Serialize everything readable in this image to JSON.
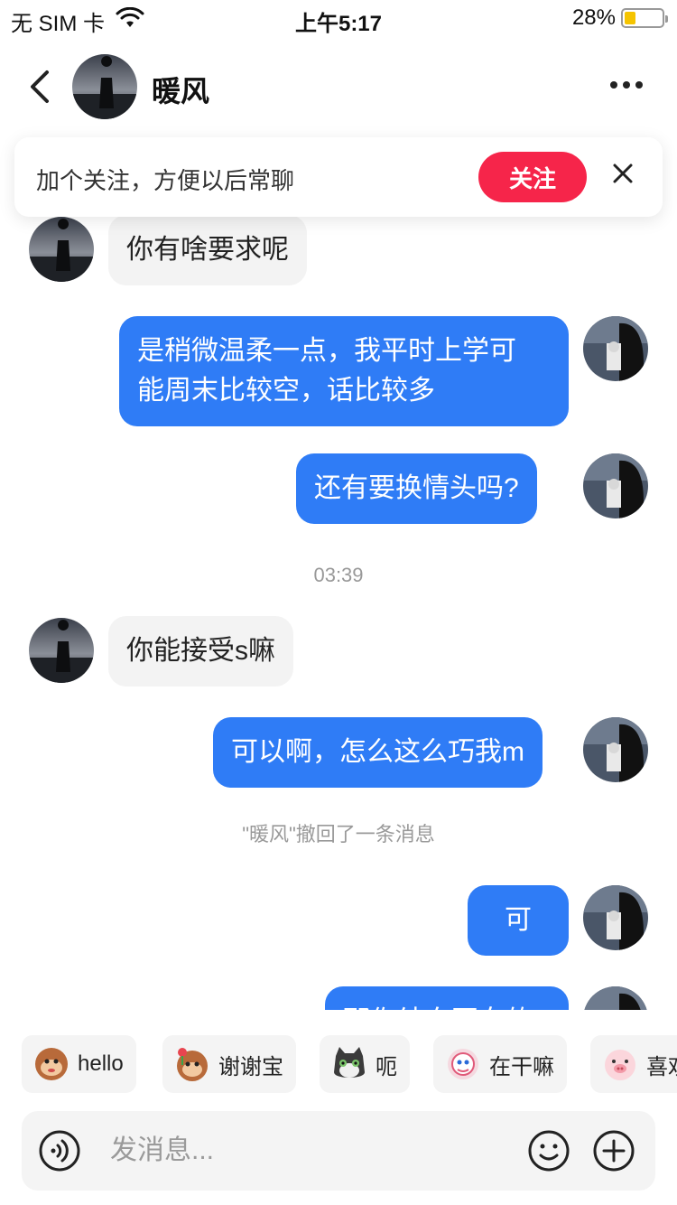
{
  "status_bar": {
    "carrier": "无 SIM 卡",
    "time": "上午5:17",
    "battery": "28%",
    "battery_level": 0.28
  },
  "header": {
    "name": "暖风"
  },
  "follow_card": {
    "text": "加个关注，方便以后常聊",
    "button": "关注"
  },
  "messages": {
    "m1": "你有啥要求呢",
    "m2_line1": "是稍微温柔一点，我平时上学可",
    "m2_line2": "能周末比较空，话比较多",
    "m3": "还有要换情头吗?",
    "time_divider": "03:39",
    "m4": "你能接受s嘛",
    "m5": "可以啊，怎么这么巧我m",
    "recall_notice": "\"暖风\"撤回了一条消息",
    "m6": "可",
    "m7_partial": "那你结白写女的"
  },
  "quick_replies": [
    {
      "label": "hello",
      "icon": "monkey-icon"
    },
    {
      "label": "谢谢宝",
      "icon": "monkey-flower-icon"
    },
    {
      "label": "呃",
      "icon": "cat-icon"
    },
    {
      "label": "在干嘛",
      "icon": "cartoon-icon"
    },
    {
      "label": "喜欢",
      "icon": "pig-icon"
    }
  ],
  "input": {
    "placeholder": "发消息..."
  },
  "colors": {
    "accent_blue": "#2f7cf6",
    "follow_red": "#f6254a",
    "incoming_bubble": "#f3f3f3"
  }
}
